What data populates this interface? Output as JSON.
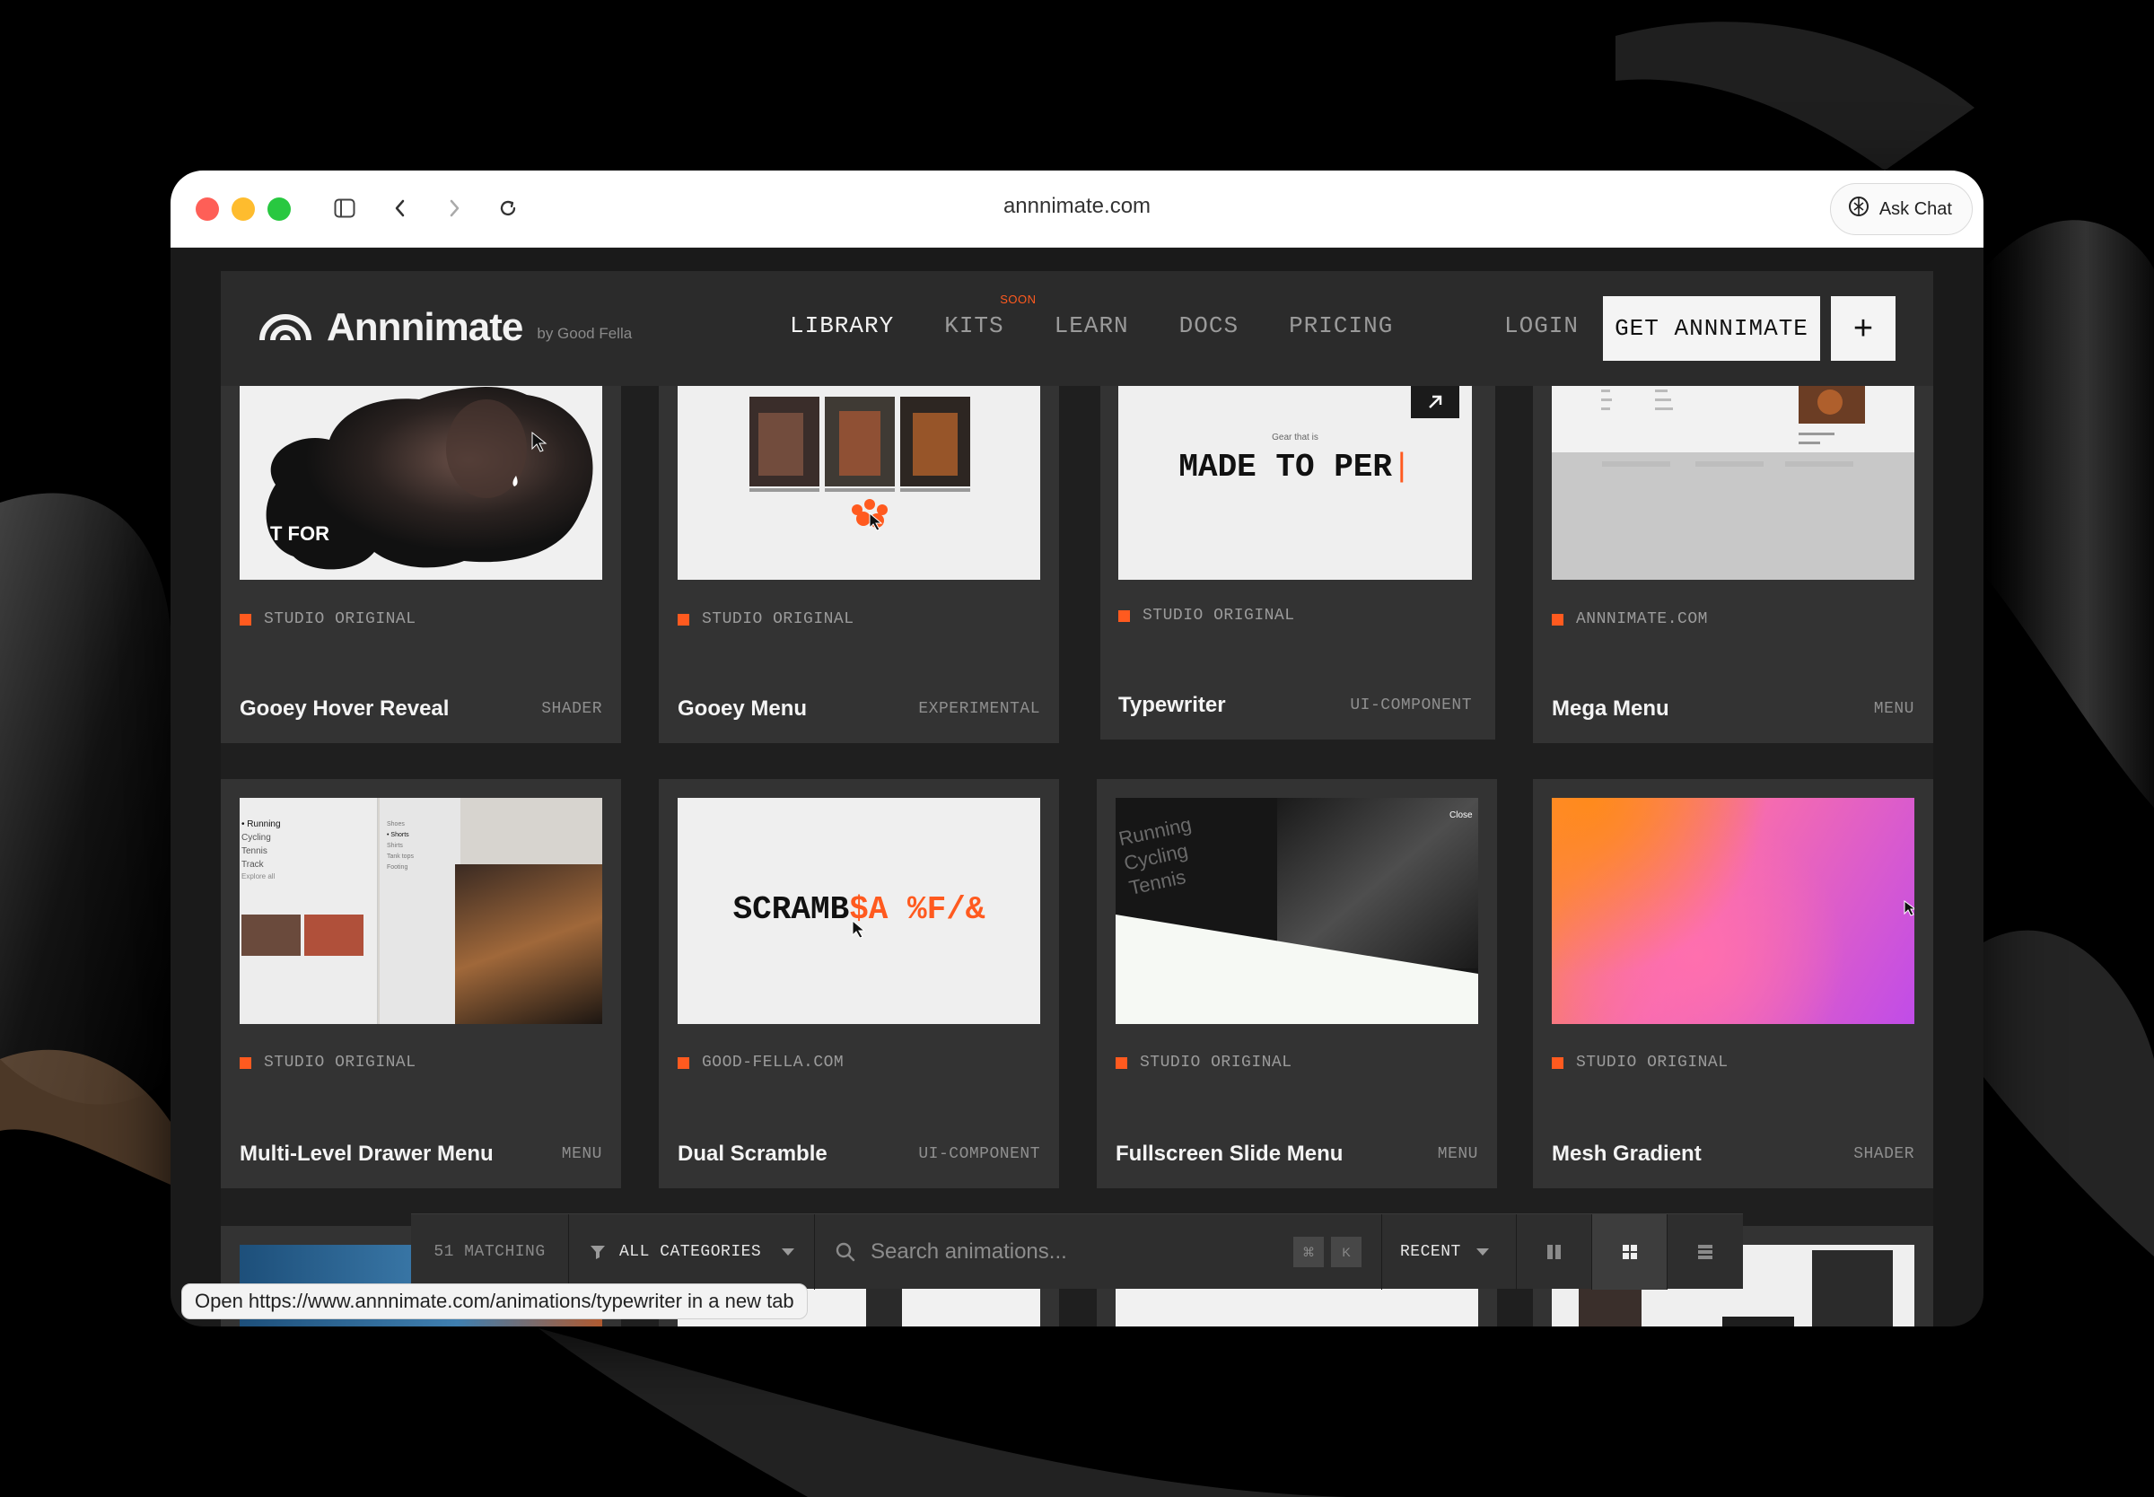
{
  "browser": {
    "url": "annnimate.com",
    "ask_chat_label": "Ask Chat",
    "status_tooltip": "Open https://www.annnimate.com/animations/typewriter in a new tab"
  },
  "nav": {
    "logo_text": "Annnimate",
    "logo_byline": "by Good Fella",
    "links": [
      {
        "label": "LIBRARY",
        "active": true
      },
      {
        "label": "KITS",
        "badge": "SOON"
      },
      {
        "label": "LEARN"
      },
      {
        "label": "DOCS"
      },
      {
        "label": "PRICING"
      }
    ],
    "login_label": "LOGIN",
    "cta_label": "GET ANNNIMATE",
    "plus_label": "+"
  },
  "cards": [
    {
      "title": "Gooey Hover Reveal",
      "source": "STUDIO ORIGINAL",
      "category": "SHADER",
      "thumb_text": "T FOR"
    },
    {
      "title": "Gooey Menu",
      "source": "STUDIO ORIGINAL",
      "category": "EXPERIMENTAL"
    },
    {
      "title": "Typewriter",
      "source": "STUDIO ORIGINAL",
      "category": "UI-COMPONENT",
      "thumb_small": "Gear that is",
      "thumb_text": "MADE TO PER"
    },
    {
      "title": "Mega Menu",
      "source": "ANNNIMATE.COM",
      "category": "MENU"
    },
    {
      "title": "Multi-Level Drawer Menu",
      "source": "STUDIO ORIGINAL",
      "category": "MENU",
      "thumb_items": [
        "Running",
        "Cycling",
        "Tennis",
        "Track",
        "Explore all"
      ],
      "thumb_items2": [
        "Shoes",
        "Shorts",
        "Shirts",
        "Tank tops",
        "Footing"
      ]
    },
    {
      "title": "Dual Scramble",
      "source": "GOOD-FELLA.COM",
      "category": "UI-COMPONENT",
      "thumb_text_a": "SCRAMB",
      "thumb_text_b": "$A %F/&"
    },
    {
      "title": "Fullscreen Slide Menu",
      "source": "STUDIO ORIGINAL",
      "category": "MENU",
      "thumb_items": [
        "Running",
        "Cycling",
        "Tennis"
      ],
      "thumb_close": "Close"
    },
    {
      "title": "Mesh Gradient",
      "source": "STUDIO ORIGINAL",
      "category": "SHADER"
    }
  ],
  "toolbar": {
    "matching": "51 MATCHING",
    "categories": "ALL CATEGORIES",
    "search_placeholder": "Search animations...",
    "kbd_1": "⌘",
    "kbd_2": "K",
    "sort": "RECENT"
  },
  "colors": {
    "accent": "#ff5a1f",
    "card_bg": "#333333",
    "page_bg": "#1f1f1f"
  }
}
